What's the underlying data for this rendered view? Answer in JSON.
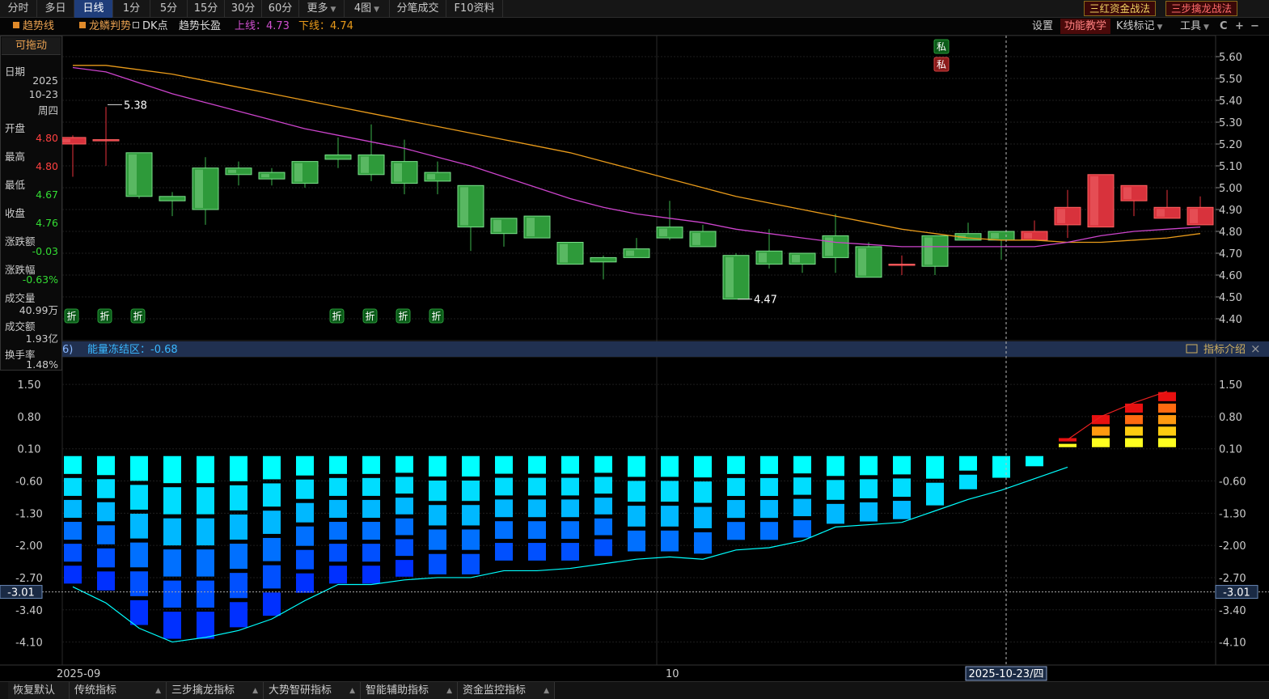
{
  "toolbar": {
    "tabs": [
      {
        "label": "分时",
        "active": false
      },
      {
        "label": "多日",
        "active": false
      },
      {
        "label": "日线",
        "active": true
      },
      {
        "label": "1分",
        "active": false
      },
      {
        "label": "5分",
        "active": false
      },
      {
        "label": "15分",
        "active": false
      },
      {
        "label": "30分",
        "active": false
      },
      {
        "label": "60分",
        "active": false
      },
      {
        "label": "更多",
        "active": false,
        "dropdown": true
      },
      {
        "label": "4图",
        "active": false,
        "dropdown": true
      },
      {
        "label": "分笔成交",
        "active": false
      },
      {
        "label": "F10资料",
        "active": false
      }
    ],
    "btn_sanhong": "三红资金战法",
    "btn_sanbu": "三步擒龙战法"
  },
  "legend": {
    "trend_line": "趋势线",
    "dragon": "龙鳞判势",
    "dk_point": "DK点",
    "trend_long": "趋势长盈",
    "upper_label": "上线：4.73",
    "lower_label": "下线：4.74",
    "settings": "设置",
    "func_teach": "功能教学",
    "kline_mark": "K线标记",
    "tools": "工具",
    "refresh_glyph": "C",
    "plus_glyph": "+",
    "minus_glyph": "−"
  },
  "draggable_label": "可拖动",
  "info_panel": {
    "date_label": "日期",
    "year": "2025",
    "md": "10-23",
    "weekday": "周四",
    "open_label": "开盘",
    "open": "4.80",
    "high_label": "最高",
    "high": "4.80",
    "low_label": "最低",
    "low": "4.67",
    "close_label": "收盘",
    "close": "4.76",
    "change_label": "涨跌额",
    "change": "-0.03",
    "pct_label": "涨跌幅",
    "pct": "-0.63%",
    "vol_label": "成交量",
    "vol": "40.99万",
    "amount_label": "成交额",
    "amount": "1.93亿",
    "turnover_label": "换手率",
    "turnover": "1.48%"
  },
  "indicator": {
    "header_num": "6)",
    "name": "能量冻结区：-0.68",
    "intro": "指标介绍",
    "close_glyph": "×"
  },
  "chart_data": [
    {
      "type": "candlestick",
      "y_ticks": [
        "5.60",
        "5.50",
        "5.40",
        "5.30",
        "5.20",
        "5.10",
        "5.00",
        "4.90",
        "4.80",
        "4.70",
        "4.60",
        "4.50",
        "4.40"
      ],
      "ylim": [
        4.4,
        5.6
      ],
      "candles": [
        {
          "o": 5.2,
          "c": 5.23,
          "h": 5.24,
          "l": 5.05
        },
        {
          "o": 5.22,
          "c": 5.22,
          "h": 5.37,
          "l": 5.1
        },
        {
          "o": 5.16,
          "c": 4.96,
          "h": 5.16,
          "l": 4.95
        },
        {
          "o": 4.96,
          "c": 4.94,
          "h": 4.98,
          "l": 4.87
        },
        {
          "o": 5.09,
          "c": 4.9,
          "h": 5.14,
          "l": 4.83
        },
        {
          "o": 5.09,
          "c": 5.06,
          "h": 5.12,
          "l": 5.01
        },
        {
          "o": 5.07,
          "c": 5.04,
          "h": 5.09,
          "l": 5.01
        },
        {
          "o": 5.12,
          "c": 5.02,
          "h": 5.12,
          "l": 5.0
        },
        {
          "o": 5.15,
          "c": 5.13,
          "h": 5.23,
          "l": 5.09
        },
        {
          "o": 5.15,
          "c": 5.06,
          "h": 5.29,
          "l": 5.03
        },
        {
          "o": 5.12,
          "c": 5.02,
          "h": 5.22,
          "l": 4.97
        },
        {
          "o": 5.07,
          "c": 5.03,
          "h": 5.12,
          "l": 4.97
        },
        {
          "o": 5.01,
          "c": 4.82,
          "h": 5.01,
          "l": 4.71
        },
        {
          "o": 4.86,
          "c": 4.79,
          "h": 4.86,
          "l": 4.73
        },
        {
          "o": 4.87,
          "c": 4.77,
          "h": 4.87,
          "l": 4.77
        },
        {
          "o": 4.75,
          "c": 4.65,
          "h": 4.75,
          "l": 4.65
        },
        {
          "o": 4.68,
          "c": 4.66,
          "h": 4.69,
          "l": 4.58
        },
        {
          "o": 4.72,
          "c": 4.68,
          "h": 4.77,
          "l": 4.68
        },
        {
          "o": 4.82,
          "c": 4.77,
          "h": 4.94,
          "l": 4.76
        },
        {
          "o": 4.8,
          "c": 4.73,
          "h": 4.83,
          "l": 4.73
        },
        {
          "o": 4.69,
          "c": 4.49,
          "h": 4.7,
          "l": 4.49
        },
        {
          "o": 4.71,
          "c": 4.65,
          "h": 4.81,
          "l": 4.63
        },
        {
          "o": 4.7,
          "c": 4.65,
          "h": 4.7,
          "l": 4.61
        },
        {
          "o": 4.78,
          "c": 4.68,
          "h": 4.88,
          "l": 4.61
        },
        {
          "o": 4.73,
          "c": 4.59,
          "h": 4.75,
          "l": 4.59
        },
        {
          "o": 4.65,
          "c": 4.65,
          "h": 4.69,
          "l": 4.6
        },
        {
          "o": 4.78,
          "c": 4.64,
          "h": 4.78,
          "l": 4.6
        },
        {
          "o": 4.79,
          "c": 4.76,
          "h": 4.84,
          "l": 4.76
        },
        {
          "o": 4.8,
          "c": 4.76,
          "h": 4.8,
          "l": 4.67
        },
        {
          "o": 4.76,
          "c": 4.8,
          "h": 4.85,
          "l": 4.76
        },
        {
          "o": 4.83,
          "c": 4.91,
          "h": 4.99,
          "l": 4.77
        },
        {
          "o": 4.82,
          "c": 5.06,
          "h": 5.06,
          "l": 4.82
        },
        {
          "o": 4.94,
          "c": 5.01,
          "h": 5.01,
          "l": 4.87
        },
        {
          "o": 4.86,
          "c": 4.91,
          "h": 4.99,
          "l": 4.86
        },
        {
          "o": 4.83,
          "c": 4.91,
          "h": 4.96,
          "l": 4.83
        }
      ],
      "trend_line_orange": [
        5.56,
        5.56,
        5.54,
        5.52,
        5.49,
        5.46,
        5.43,
        5.4,
        5.37,
        5.34,
        5.31,
        5.28,
        5.25,
        5.22,
        5.19,
        5.16,
        5.12,
        5.08,
        5.04,
        5.0,
        4.96,
        4.93,
        4.9,
        4.87,
        4.84,
        4.81,
        4.79,
        4.77,
        4.76,
        4.76,
        4.75,
        4.75,
        4.76,
        4.77,
        4.79
      ],
      "trend_line_purple": [
        5.55,
        5.53,
        5.48,
        5.43,
        5.39,
        5.35,
        5.31,
        5.27,
        5.24,
        5.21,
        5.18,
        5.14,
        5.1,
        5.05,
        5.0,
        4.95,
        4.91,
        4.88,
        4.86,
        4.84,
        4.81,
        4.79,
        4.77,
        4.75,
        4.74,
        4.73,
        4.73,
        4.73,
        4.73,
        4.73,
        4.75,
        4.78,
        4.8,
        4.81,
        4.82
      ],
      "annotations": [
        {
          "text": "5.38",
          "index": 1,
          "y": 5.38
        },
        {
          "text": "4.47",
          "index": 20,
          "y": 4.49
        }
      ],
      "zhe_marker": "折",
      "zhe_indices": [
        0,
        1,
        2,
        8,
        9,
        10,
        11
      ],
      "si_marker": "私",
      "si_index": 26,
      "x_labels": [
        {
          "text": "2025-09",
          "index": 0
        },
        {
          "text": "10",
          "index": 18
        }
      ],
      "cursor_label": "2025-10-23/四",
      "cursor_index": 28
    },
    {
      "type": "bar",
      "name": "能量冻结区",
      "y_ticks": [
        "1.50",
        "0.80",
        "0.10",
        "-0.60",
        "-1.30",
        "-2.00",
        "-2.70",
        "-3.40",
        "-4.10"
      ],
      "ylim": [
        -4.6,
        2.1
      ],
      "current_value": "-3.01",
      "current_y": -3.01,
      "values": [
        -2.9,
        -3.05,
        -3.8,
        -4.1,
        -4.1,
        -3.85,
        -3.6,
        -3.1,
        -2.9,
        -2.9,
        -2.75,
        -2.7,
        -2.7,
        -2.4,
        -2.4,
        -2.4,
        -2.3,
        -2.2,
        -2.2,
        -2.25,
        -1.95,
        -1.95,
        -1.9,
        -1.6,
        -1.55,
        -1.5,
        -1.2,
        -0.85,
        -0.6,
        -0.35,
        0.35,
        0.85,
        1.1,
        1.35
      ],
      "cyan_line": [
        -2.9,
        -3.25,
        -3.8,
        -4.1,
        -4.0,
        -3.85,
        -3.6,
        -3.2,
        -2.85,
        -2.85,
        -2.75,
        -2.7,
        -2.7,
        -2.55,
        -2.55,
        -2.5,
        -2.4,
        -2.3,
        -2.25,
        -2.3,
        -2.1,
        -2.05,
        -1.9,
        -1.6,
        -1.55,
        -1.5,
        -1.25,
        -1.0,
        -0.8,
        -0.55,
        -0.3
      ],
      "red_line": [
        0.3,
        0.8,
        1.1,
        1.35
      ]
    }
  ],
  "bottom_tabs": [
    {
      "label": "恢复默认",
      "dropdown": false
    },
    {
      "label": "传统指标",
      "dropdown": true
    },
    {
      "label": "三步擒龙指标",
      "dropdown": true
    },
    {
      "label": "大势智研指标",
      "dropdown": true
    },
    {
      "label": "智能辅助指标",
      "dropdown": true
    },
    {
      "label": "资金监控指标",
      "dropdown": true
    }
  ],
  "colors": {
    "up": "#e8323c",
    "down": "#3cb44b",
    "orange": "#e89a1a",
    "purple": "#cc44cc",
    "cyan": "#00ffff",
    "blue": "#0030ff"
  }
}
